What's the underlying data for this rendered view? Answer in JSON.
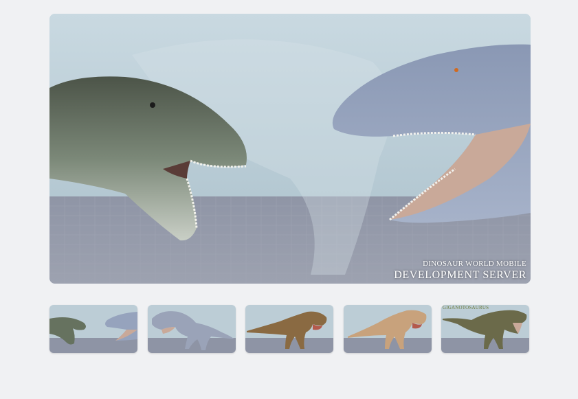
{
  "main": {
    "caption_line1": "DINOSAUR WORLD MOBILE",
    "caption_line2": "DEVELOPMENT SERVER"
  },
  "thumbnails": [
    {
      "name": "thumb-1",
      "subject": "two dinosaurs facing each other",
      "selected": true
    },
    {
      "name": "thumb-2",
      "subject": "grey theropod walking"
    },
    {
      "name": "thumb-3",
      "subject": "brown theropod roaring"
    },
    {
      "name": "thumb-4",
      "subject": "tan theropod roaring"
    },
    {
      "name": "thumb-5",
      "subject": "giganotosaurus",
      "caption": "GIGANOTOSAURUS"
    }
  ],
  "colors": {
    "page_bg": "#f0f1f3",
    "sky": "#b9ccd6",
    "floor": "#8c92a3",
    "caption_text": "#ffffff"
  }
}
